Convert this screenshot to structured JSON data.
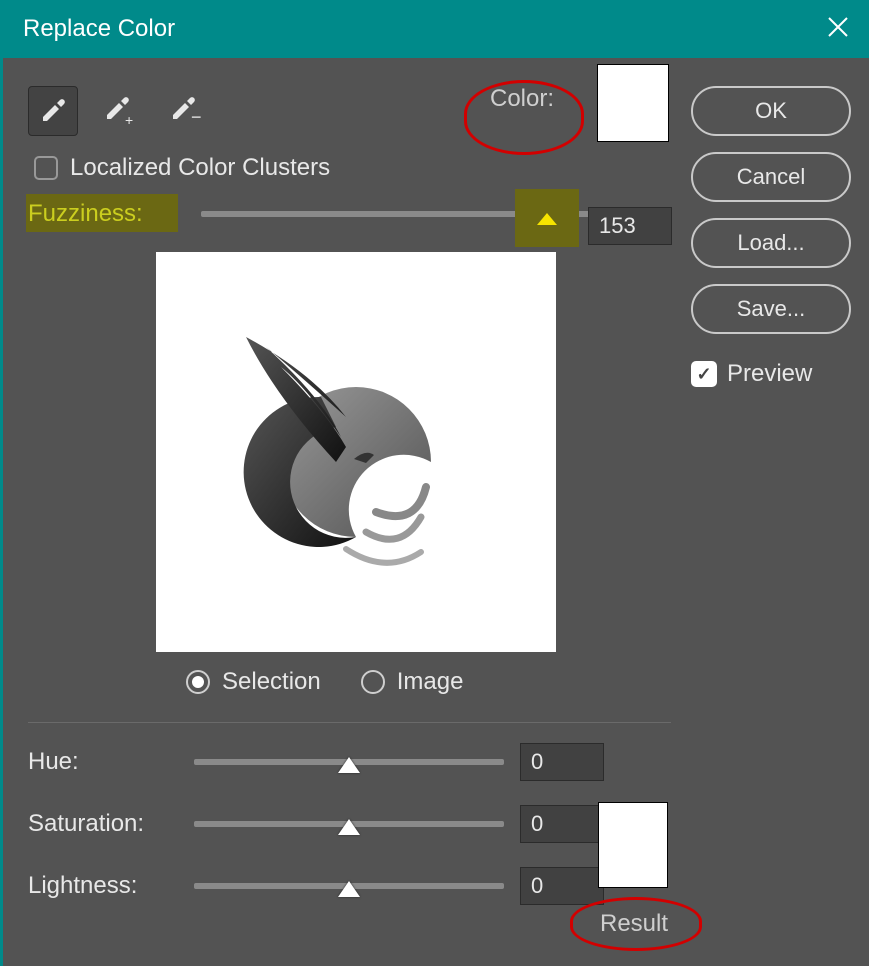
{
  "titlebar": {
    "title": "Replace Color"
  },
  "sidebar": {
    "ok": "OK",
    "cancel": "Cancel",
    "load": "Load...",
    "save": "Save...",
    "preview": "Preview",
    "preview_checked": true
  },
  "selection": {
    "localized_label": "Localized Color Clusters",
    "color_label": "Color:",
    "color_swatch": "#ffffff",
    "fuzziness_label": "Fuzziness:",
    "fuzziness_value": "153",
    "radio_selection": "Selection",
    "radio_image": "Image",
    "radio_value": "selection"
  },
  "replacement": {
    "hue_label": "Hue:",
    "hue_value": "0",
    "saturation_label": "Saturation:",
    "saturation_value": "0",
    "lightness_label": "Lightness:",
    "lightness_value": "0",
    "result_label": "Result",
    "result_swatch": "#ffffff"
  }
}
